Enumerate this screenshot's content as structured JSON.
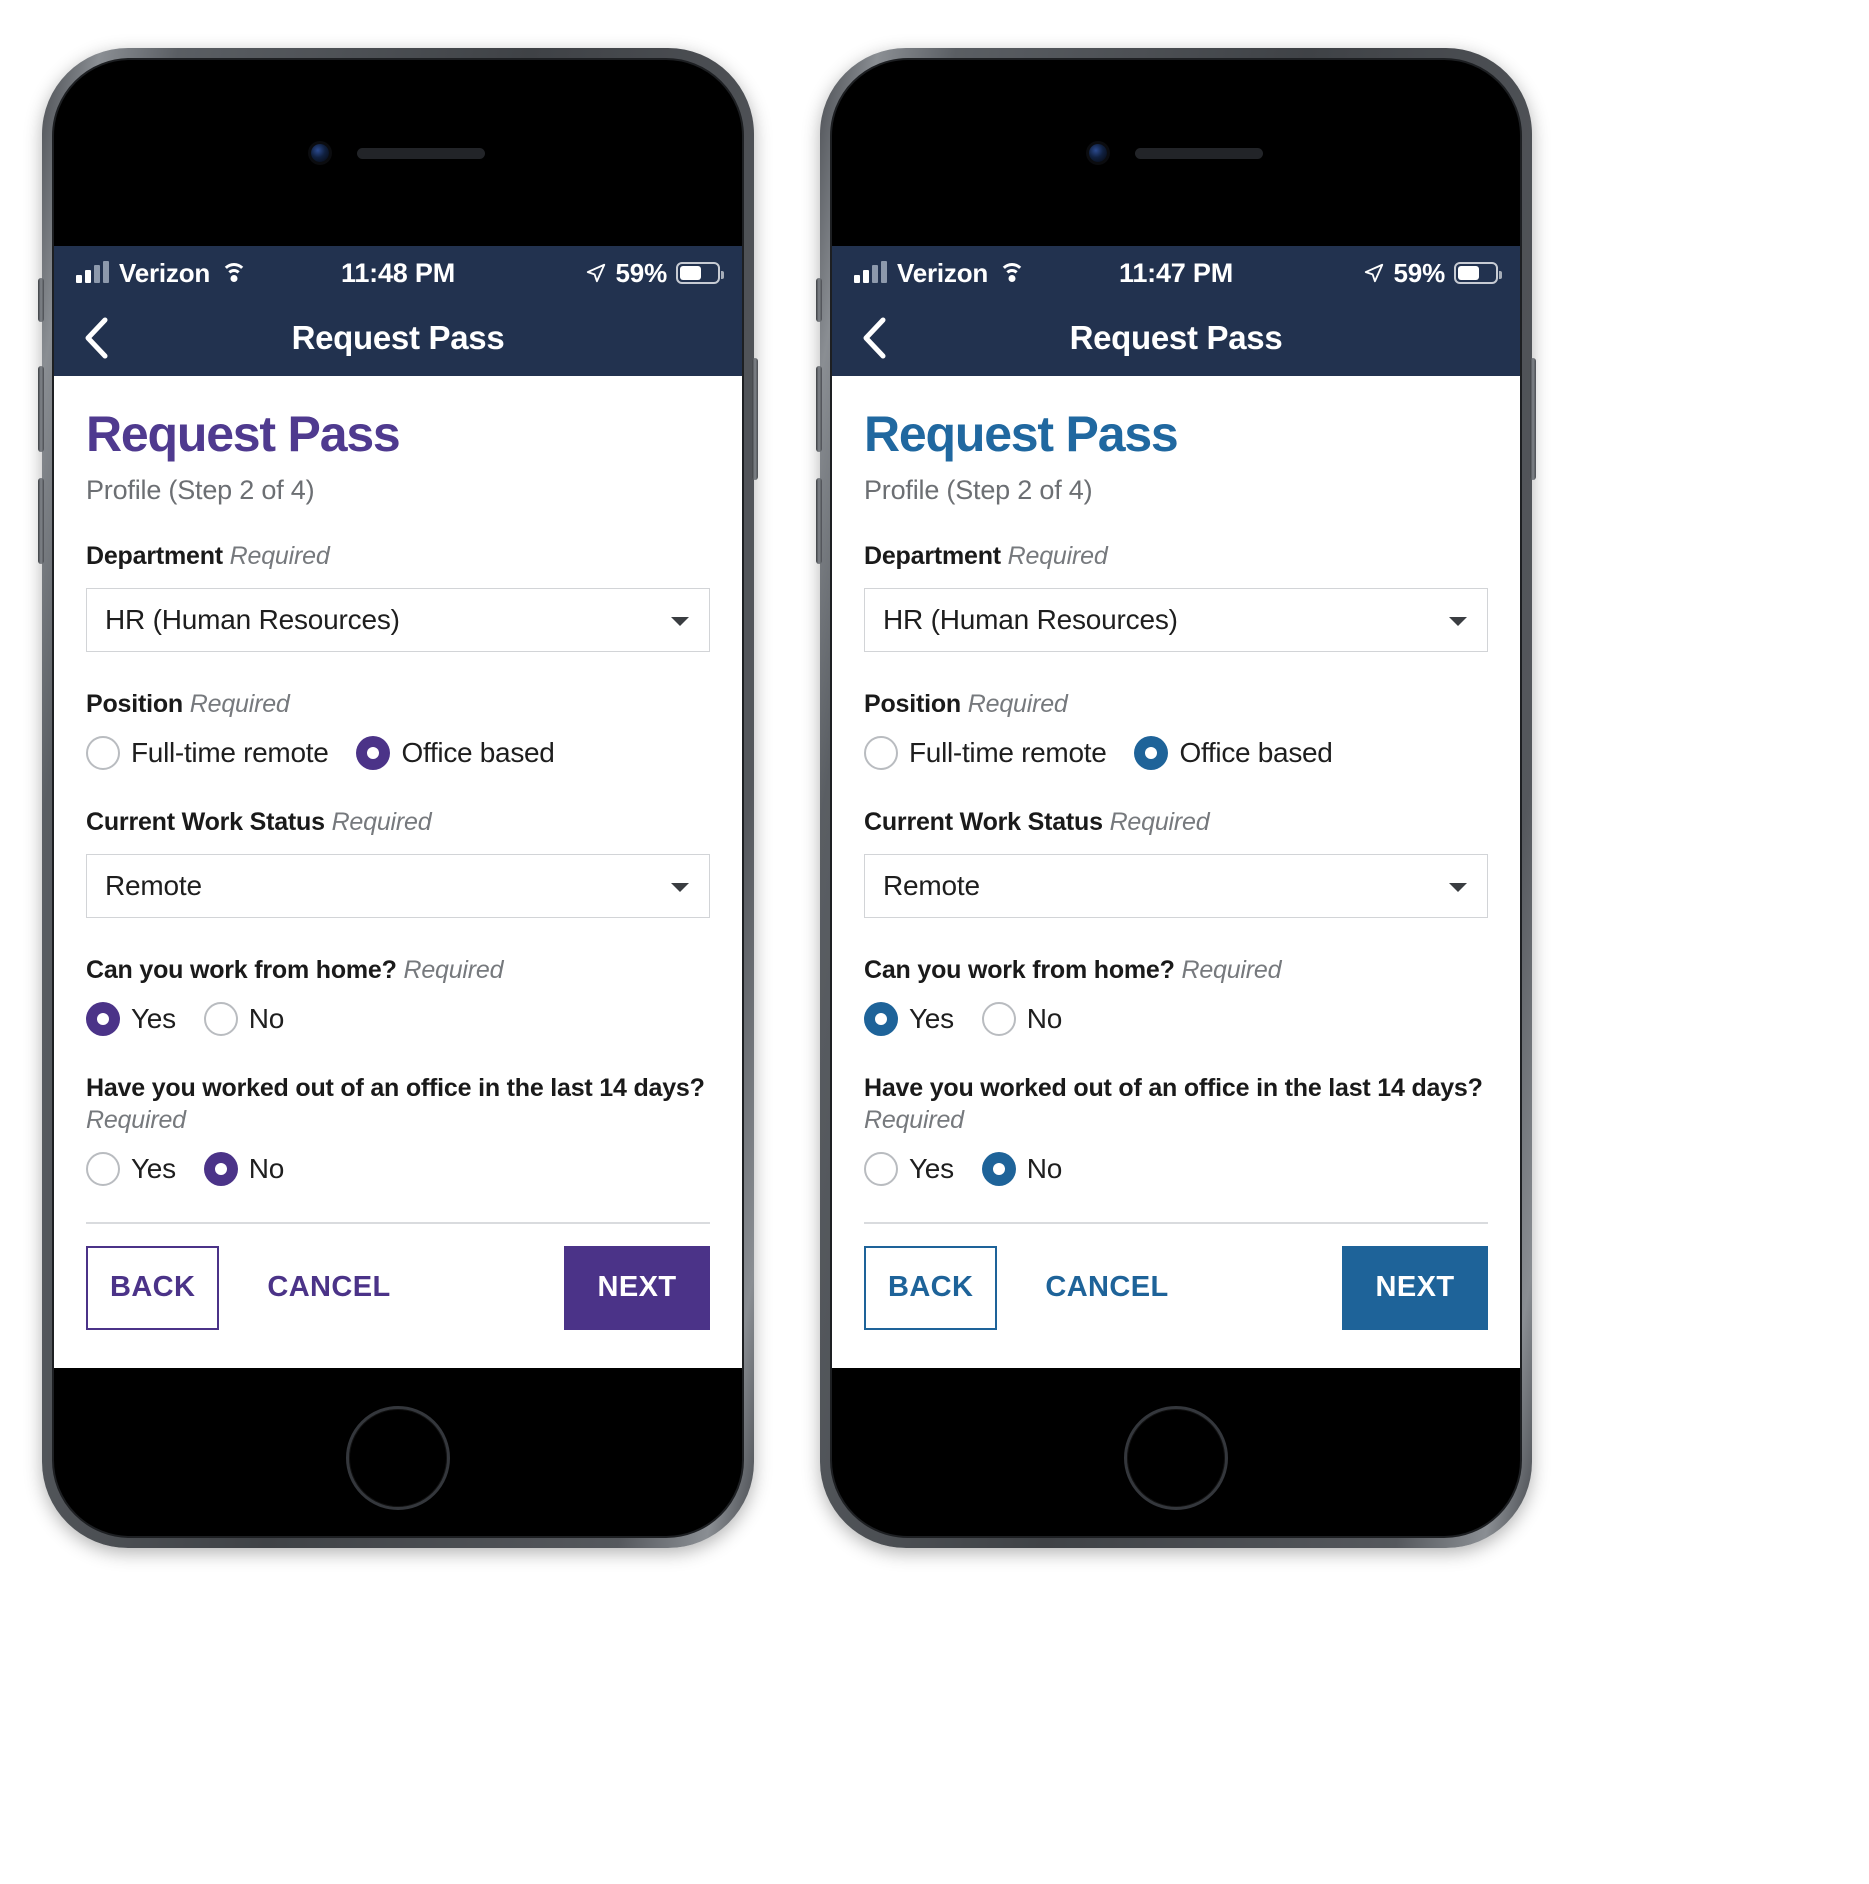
{
  "theme": {
    "purple": {
      "accent": "#4b3388",
      "heading": "#4f3a8f",
      "navbar_bg": "#22324f",
      "statusbar_bg": "#22324f"
    },
    "blue": {
      "accent": "#1e6399",
      "heading": "#2068a0",
      "navbar_bg": "#22324f",
      "statusbar_bg": "#22324f"
    }
  },
  "phones": [
    {
      "variant": "purple",
      "status_bar": {
        "carrier": "Verizon",
        "time": "11:48 PM",
        "battery_percent": "59%",
        "signal_icon": "cellular-signal-icon",
        "wifi_icon": "wifi-icon",
        "location_icon": "location-arrow-icon",
        "battery_icon": "battery-icon"
      },
      "nav": {
        "back_icon": "chevron-left-icon",
        "title": "Request Pass"
      },
      "page": {
        "title": "Request Pass",
        "subtitle": "Profile (Step 2 of 4)"
      },
      "fields": {
        "department": {
          "label": "Department",
          "required": "Required",
          "value": "HR (Human Resources)",
          "caret_icon": "chevron-down-icon"
        },
        "position": {
          "label": "Position",
          "required": "Required",
          "options": [
            {
              "label": "Full-time remote",
              "selected": false
            },
            {
              "label": "Office based",
              "selected": true
            }
          ]
        },
        "work_status": {
          "label": "Current Work Status",
          "required": "Required",
          "value": "Remote",
          "caret_icon": "chevron-down-icon"
        },
        "work_from_home": {
          "label": "Can you work from home?",
          "required": "Required",
          "options": [
            {
              "label": "Yes",
              "selected": true
            },
            {
              "label": "No",
              "selected": false
            }
          ]
        },
        "office_last_14_days": {
          "label": "Have you worked out of an office in the last 14 days?",
          "required": "Required",
          "options": [
            {
              "label": "Yes",
              "selected": false
            },
            {
              "label": "No",
              "selected": true
            }
          ]
        }
      },
      "actions": {
        "back": "BACK",
        "cancel": "CANCEL",
        "next": "NEXT"
      }
    },
    {
      "variant": "blue",
      "status_bar": {
        "carrier": "Verizon",
        "time": "11:47 PM",
        "battery_percent": "59%",
        "signal_icon": "cellular-signal-icon",
        "wifi_icon": "wifi-icon",
        "location_icon": "location-arrow-icon",
        "battery_icon": "battery-icon"
      },
      "nav": {
        "back_icon": "chevron-left-icon",
        "title": "Request Pass"
      },
      "page": {
        "title": "Request Pass",
        "subtitle": "Profile (Step 2 of 4)"
      },
      "fields": {
        "department": {
          "label": "Department",
          "required": "Required",
          "value": "HR (Human Resources)",
          "caret_icon": "chevron-down-icon"
        },
        "position": {
          "label": "Position",
          "required": "Required",
          "options": [
            {
              "label": "Full-time remote",
              "selected": false
            },
            {
              "label": "Office based",
              "selected": true
            }
          ]
        },
        "work_status": {
          "label": "Current Work Status",
          "required": "Required",
          "value": "Remote",
          "caret_icon": "chevron-down-icon"
        },
        "work_from_home": {
          "label": "Can you work from home?",
          "required": "Required",
          "options": [
            {
              "label": "Yes",
              "selected": true
            },
            {
              "label": "No",
              "selected": false
            }
          ]
        },
        "office_last_14_days": {
          "label": "Have you worked out of an office in the last 14 days?",
          "required": "Required",
          "options": [
            {
              "label": "Yes",
              "selected": false
            },
            {
              "label": "No",
              "selected": true
            }
          ]
        }
      },
      "actions": {
        "back": "BACK",
        "cancel": "CANCEL",
        "next": "NEXT"
      }
    }
  ]
}
